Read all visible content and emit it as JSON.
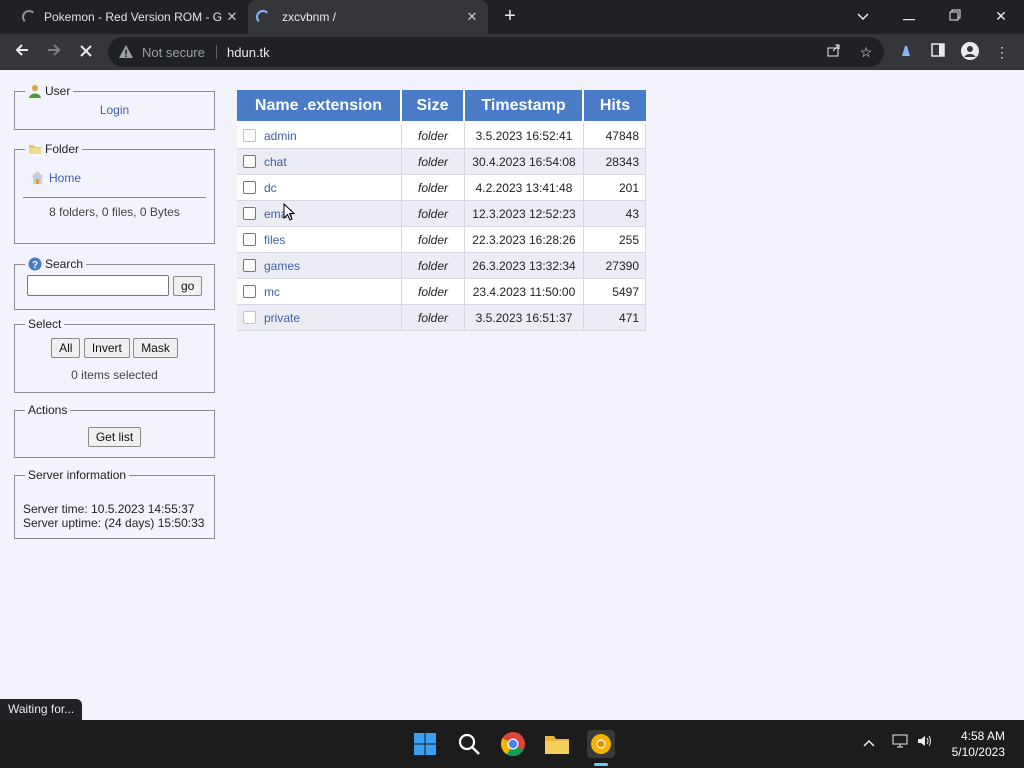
{
  "browser": {
    "tabs": [
      {
        "title": "Pokemon - Red Version ROM - G",
        "active": false
      },
      {
        "title": "zxcvbnm /",
        "active": true
      }
    ],
    "address": {
      "security_label": "Not secure",
      "url": "hdun.tk"
    }
  },
  "sidebar": {
    "user": {
      "legend": "User",
      "login_link": "Login"
    },
    "folder": {
      "legend": "Folder",
      "home_link": "Home",
      "summary": "8 folders, 0 files, 0 Bytes"
    },
    "search": {
      "legend": "Search",
      "input_value": "",
      "go_label": "go"
    },
    "select": {
      "legend": "Select",
      "all_label": "All",
      "invert_label": "Invert",
      "mask_label": "Mask",
      "status": "0 items selected"
    },
    "actions": {
      "legend": "Actions",
      "get_list_label": "Get list"
    },
    "server": {
      "legend": "Server information",
      "time": "Server time: 10.5.2023 14:55:37",
      "uptime": "Server uptime: (24 days) 15:50:33"
    }
  },
  "file_table": {
    "headers": {
      "name": "Name .extension",
      "size": "Size",
      "timestamp": "Timestamp",
      "hits": "Hits"
    },
    "rows": [
      {
        "name": "admin",
        "size": "folder",
        "timestamp": "3.5.2023 16:52:41",
        "hits": "47848",
        "selectable": false
      },
      {
        "name": "chat",
        "size": "folder",
        "timestamp": "30.4.2023 16:54:08",
        "hits": "28343",
        "selectable": true
      },
      {
        "name": "dc",
        "size": "folder",
        "timestamp": "4.2.2023 13:41:48",
        "hits": "201",
        "selectable": true
      },
      {
        "name": "email",
        "size": "folder",
        "timestamp": "12.3.2023 12:52:23",
        "hits": "43",
        "selectable": true
      },
      {
        "name": "files",
        "size": "folder",
        "timestamp": "22.3.2023 16:28:26",
        "hits": "255",
        "selectable": true
      },
      {
        "name": "games",
        "size": "folder",
        "timestamp": "26.3.2023 13:32:34",
        "hits": "27390",
        "selectable": true
      },
      {
        "name": "mc",
        "size": "folder",
        "timestamp": "23.4.2023 11:50:00",
        "hits": "5497",
        "selectable": true
      },
      {
        "name": "private",
        "size": "folder",
        "timestamp": "3.5.2023 16:51:37",
        "hits": "471",
        "selectable": false
      }
    ]
  },
  "status_bar": {
    "text": "Waiting for..."
  },
  "taskbar": {
    "time": "4:58 AM",
    "date": "5/10/2023"
  },
  "colors": {
    "table_header": "#4a7bc7",
    "link": "#3c5fa8",
    "page_bg": "#f3f3fc"
  }
}
